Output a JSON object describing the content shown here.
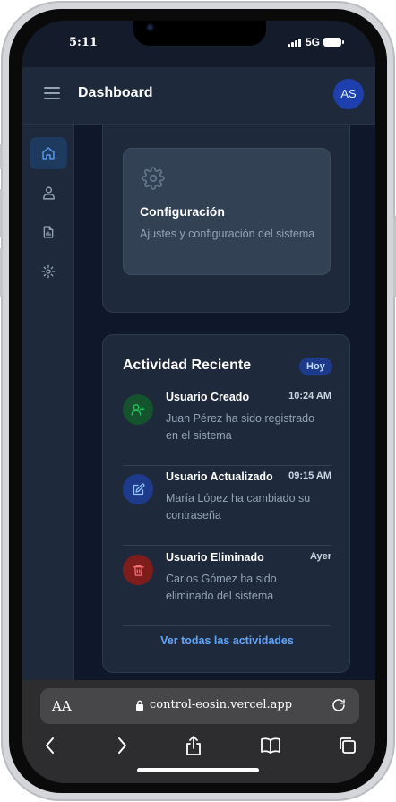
{
  "status_bar": {
    "time": "5:11",
    "network": "5G"
  },
  "header": {
    "title": "Dashboard",
    "avatar_initials": "AS"
  },
  "sidebar": {
    "items": [
      {
        "icon": "home-icon",
        "active": true
      },
      {
        "icon": "users-icon",
        "active": false
      },
      {
        "icon": "report-icon",
        "active": false
      },
      {
        "icon": "gear-icon",
        "active": false
      }
    ]
  },
  "config_card": {
    "icon": "gear-icon",
    "title": "Configuración",
    "description": "Ajustes y configuración del sistema"
  },
  "activity": {
    "title": "Actividad Reciente",
    "badge": "Hoy",
    "items": [
      {
        "icon": "user-plus-icon",
        "title": "Usuario Creado",
        "time": "10:24 AM",
        "description": "Juan Pérez ha sido registrado en el sistema",
        "color": "#22c55e"
      },
      {
        "icon": "edit-icon",
        "title": "Usuario Actualizado",
        "time": "09:15 AM",
        "description": "María López ha cambiado su contraseña",
        "color": "#60a5fa"
      },
      {
        "icon": "trash-icon",
        "title": "Usuario Eliminado",
        "time": "Ayer",
        "description": "Carlos Gómez ha sido eliminado del sistema",
        "color": "#f87171"
      }
    ],
    "view_all_link": "Ver todas las actividades"
  },
  "browser": {
    "text_size_label": "AA",
    "url": "control-eosin.vercel.app"
  },
  "colors": {
    "accent": "#60a5fa",
    "background": "#0f172a",
    "card": "#1e293b"
  }
}
